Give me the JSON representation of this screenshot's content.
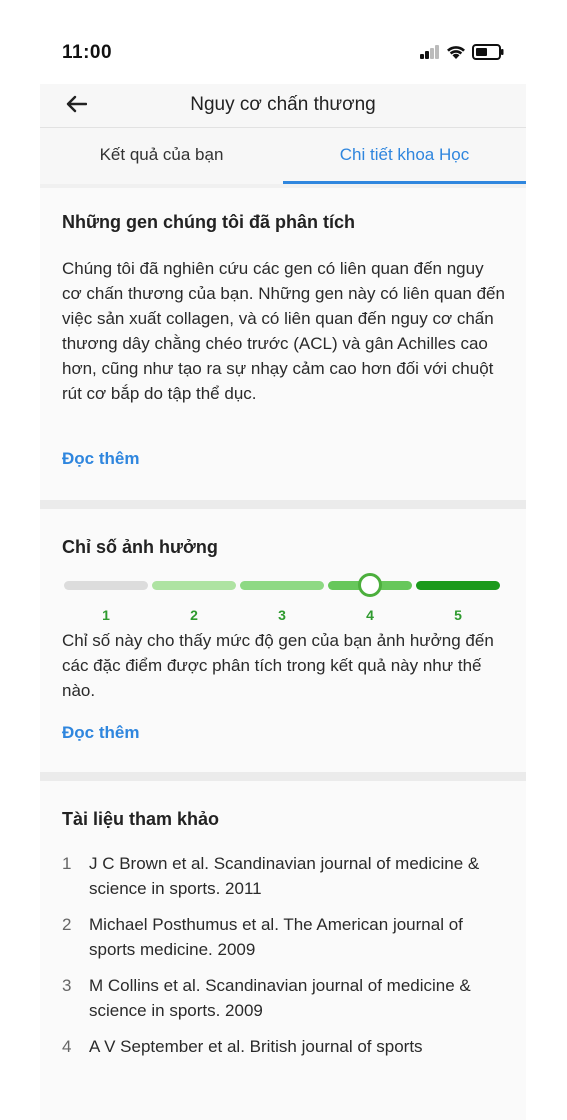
{
  "status_bar": {
    "time": "11:00"
  },
  "header": {
    "title": "Nguy cơ chấn thương"
  },
  "tabs": [
    {
      "label": "Kết quả của bạn",
      "active": false
    },
    {
      "label": "Chi tiết khoa Học",
      "active": true
    }
  ],
  "genes_section": {
    "title": "Những gen chúng tôi đã phân tích",
    "body": "Chúng tôi đã nghiên cứu các gen có liên quan đến nguy cơ chấn thương của bạn. Những gen này có liên quan đến việc sản xuất collagen, và có liên quan đến nguy cơ chấn thương dây chằng chéo trước (ACL) và gân Achilles cao hơn, cũng như tạo ra sự nhạy cảm cao hơn đối với chuột rút cơ bắp do tập thể dục.",
    "read_more": "Đọc thêm"
  },
  "impact_section": {
    "title": "Chỉ số ảnh hưởng",
    "scale_labels": [
      "1",
      "2",
      "3",
      "4",
      "5"
    ],
    "selected_level": 4,
    "body": "Chỉ số này cho thấy mức độ gen của bạn ảnh hưởng đến các đặc điểm được phân tích trong kết quả này như thế nào.",
    "read_more": "Đọc thêm"
  },
  "references_section": {
    "title": "Tài liệu tham khảo",
    "items": [
      {
        "num": "1",
        "text": "J C Brown et al. Scandinavian journal of medicine & science in sports. 2011"
      },
      {
        "num": "2",
        "text": "Michael Posthumus et al. The American journal of sports medicine. 2009"
      },
      {
        "num": "3",
        "text": "M Collins et al. Scandinavian journal of medicine & science in sports. 2009"
      },
      {
        "num": "4",
        "text": "A V September et al. British journal of sports"
      }
    ]
  },
  "colors": {
    "accent": "#2f86de",
    "scale_level_1": "#dcdcdc",
    "scale_level_2": "#aee3a2",
    "scale_level_3": "#8ed984",
    "scale_level_4": "#67c75b",
    "scale_level_5": "#1b9a1b",
    "scale_label": "#2e9a2e"
  },
  "icons": {
    "back": "arrow-left-icon",
    "signal": "cellular-signal-icon",
    "wifi": "wifi-icon",
    "battery": "battery-icon"
  }
}
